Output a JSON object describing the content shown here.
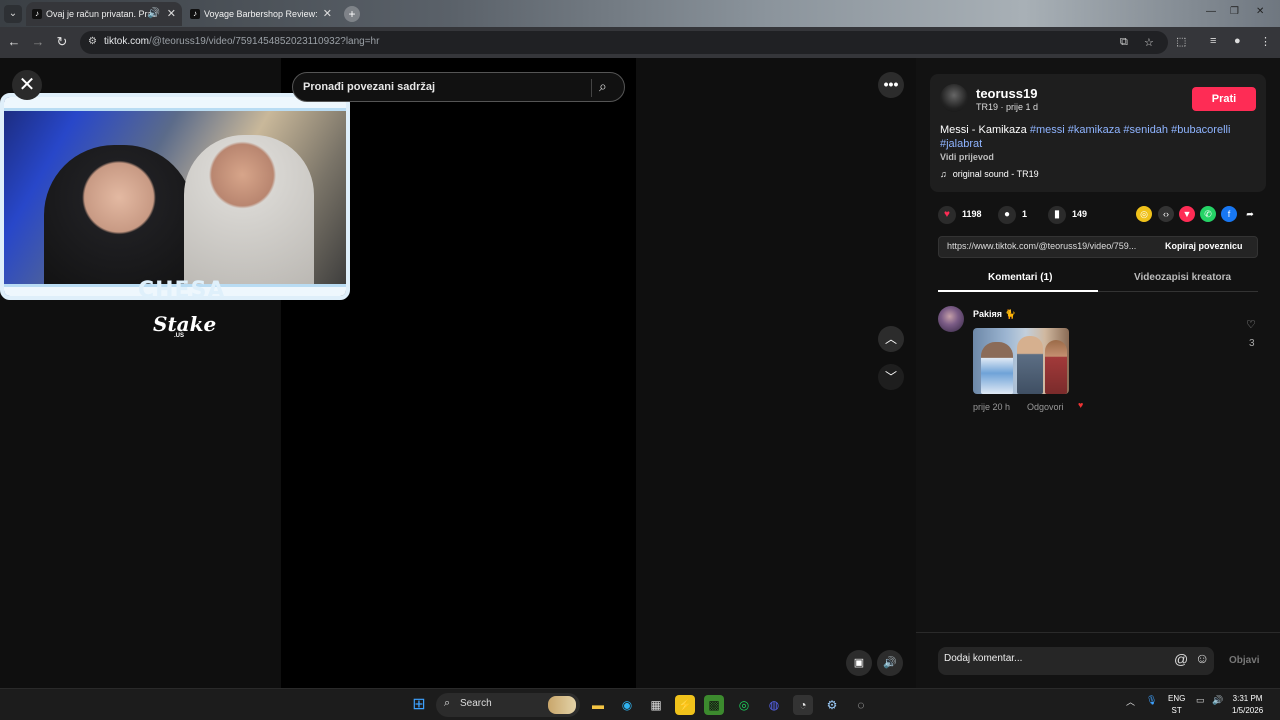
{
  "browser": {
    "tabs": [
      {
        "title": "Ovaj je račun privatan. Prati",
        "active": true
      },
      {
        "title": "Voyage Barbershop Review:",
        "active": false
      }
    ],
    "url_host": "tiktok.com",
    "url_path": "/@teoruss19/video/7591454852023110932?lang=hr"
  },
  "video": {
    "search_placeholder": "Pronađi povezani sadržaj",
    "overlay_brand": "CHESA",
    "overlay_sponsor": "Stake",
    "overlay_sponsor_sub": ".US"
  },
  "post": {
    "username": "teoruss19",
    "meta": "TR19 · prije 1 d",
    "follow_label": "Prati",
    "description_text": "Messi - Kamikaza ",
    "hashtags": "#messi #kamikaza #senidah #bubacorelli #jalabrat",
    "translate_label": "Vidi prijevod",
    "sound": "original sound - TR19",
    "likes": "1198",
    "comments": "1",
    "saves": "149",
    "link": "https://www.tiktok.com/@teoruss19/video/759...",
    "copy_label": "Kopiraj poveznicu"
  },
  "tabs": {
    "comments": "Komentari (1)",
    "creator_videos": "Videozapisi kreatora"
  },
  "comment": {
    "user": "Pakiяя 🐈",
    "time": "prije 20 h",
    "reply": "Odgovori",
    "like_count": "3"
  },
  "composer": {
    "placeholder": "Dodaj komentar...",
    "post_label": "Objavi"
  },
  "taskbar": {
    "search": "Search",
    "lang_top": "ENG",
    "lang_bottom": "ST",
    "time": "3:31 PM",
    "date": "1/5/2026"
  },
  "colors": {
    "accent": "#fe2c55",
    "hashtag": "#8fb4ff"
  }
}
